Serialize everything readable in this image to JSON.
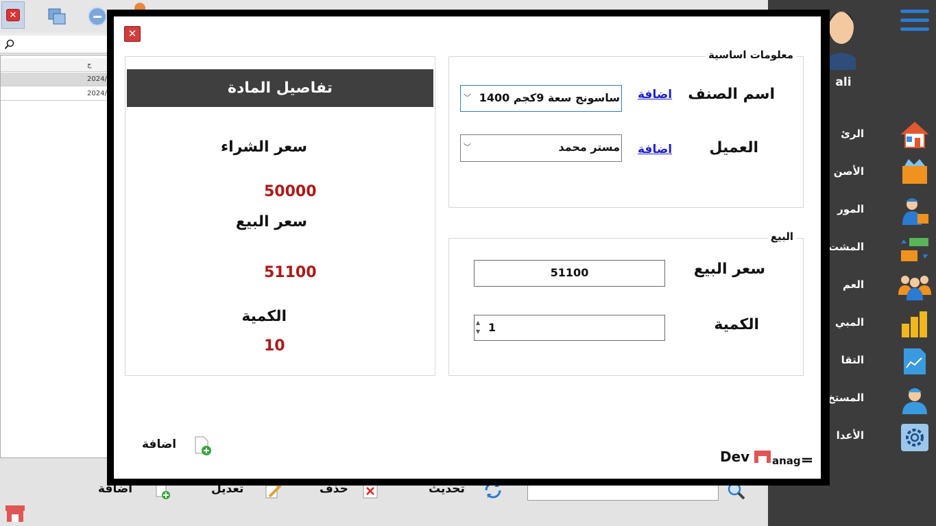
{
  "background": {
    "grid_rows": [
      "2024/",
      "2024/"
    ],
    "grid_header": "ج",
    "bottom_actions": {
      "add": "اضافة",
      "edit": "تعديل",
      "delete": "حذف",
      "refresh": "تحديث"
    }
  },
  "sidebar": {
    "user_name": "ali",
    "items": [
      {
        "label": "الرئ",
        "icon": "home-icon"
      },
      {
        "label": "الأصن",
        "icon": "box-icon"
      },
      {
        "label": "المور",
        "icon": "supplier-icon"
      },
      {
        "label": "المشت",
        "icon": "purchases-icon"
      },
      {
        "label": "العم",
        "icon": "customers-icon"
      },
      {
        "label": "المبي",
        "icon": "sales-icon"
      },
      {
        "label": "التقا",
        "icon": "reports-icon"
      },
      {
        "label": "المستخ",
        "icon": "user-icon"
      },
      {
        "label": "الأعدا",
        "icon": "settings-icon"
      }
    ]
  },
  "modal": {
    "basic_info": {
      "legend": "معلومات اساسية",
      "item_label": "اسم الصنف",
      "item_value": "ساسونج سعة 9كجم 1400",
      "item_add_link": "اضافة",
      "customer_label": "العميل",
      "customer_value": "مستر محمد",
      "customer_add_link": "اضافة"
    },
    "sale": {
      "legend": "البيع",
      "price_label": "سعر البيع",
      "price_value": "51100",
      "qty_label": "الكمية",
      "qty_value": "1"
    },
    "details": {
      "header": "تفاصيل المادة",
      "purchase_price_label": "سعر الشراء",
      "purchase_price_value": "50000",
      "sale_price_label": "سعر البيع",
      "sale_price_value": "51100",
      "qty_label": "الكمية",
      "qty_value": "10"
    },
    "add_button": "اضافة",
    "brand": "DevManage"
  },
  "colors": {
    "accent_blue": "#2b7bd2",
    "value_red": "#b01818",
    "sidebar_bg": "#3c3c3c",
    "header_dark": "#3f3f3f"
  }
}
